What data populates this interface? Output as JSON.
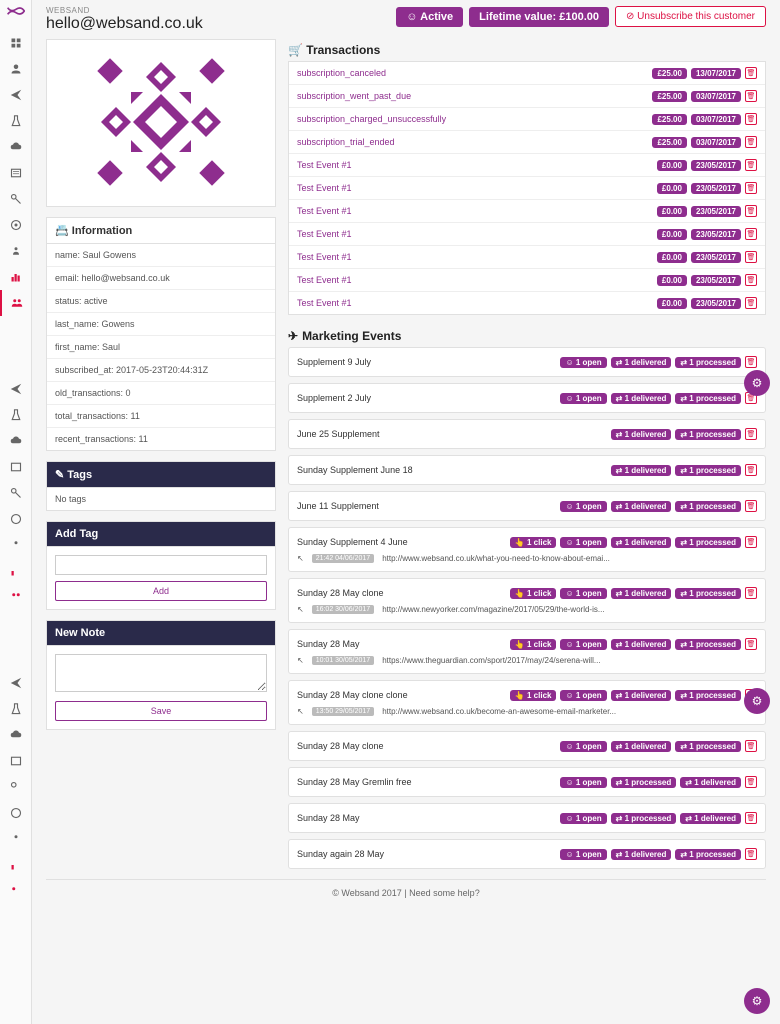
{
  "brand": "WEBSAND",
  "email": "hello@websand.co.uk",
  "status_badge": "☺ Active",
  "ltv_badge": "Lifetime value: £100.00",
  "unsub_btn": "⊘ Unsubscribe this customer",
  "info": {
    "header": "Information",
    "rows": [
      "name: Saul Gowens",
      "email: hello@websand.co.uk",
      "status: active",
      "last_name: Gowens",
      "first_name: Saul",
      "subscribed_at: 2017-05-23T20:44:31Z",
      "old_transactions: 0",
      "total_transactions: 11",
      "recent_transactions: 11"
    ]
  },
  "tags": {
    "header": "✎ Tags",
    "body": "No tags"
  },
  "addtag": {
    "header": "Add Tag",
    "btn": "Add"
  },
  "newnote": {
    "header": "New Note",
    "btn": "Save"
  },
  "tx": {
    "header": "🛒 Transactions",
    "rows": [
      {
        "name": "subscription_canceled",
        "amount": "£25.00",
        "date": "13/07/2017"
      },
      {
        "name": "subscription_went_past_due",
        "amount": "£25.00",
        "date": "03/07/2017"
      },
      {
        "name": "subscription_charged_unsuccessfully",
        "amount": "£25.00",
        "date": "03/07/2017"
      },
      {
        "name": "subscription_trial_ended",
        "amount": "£25.00",
        "date": "03/07/2017"
      },
      {
        "name": "Test Event #1",
        "amount": "£0.00",
        "date": "23/05/2017"
      },
      {
        "name": "Test Event #1",
        "amount": "£0.00",
        "date": "23/05/2017"
      },
      {
        "name": "Test Event #1",
        "amount": "£0.00",
        "date": "23/05/2017"
      },
      {
        "name": "Test Event #1",
        "amount": "£0.00",
        "date": "23/05/2017"
      },
      {
        "name": "Test Event #1",
        "amount": "£0.00",
        "date": "23/05/2017"
      },
      {
        "name": "Test Event #1",
        "amount": "£0.00",
        "date": "23/05/2017"
      },
      {
        "name": "Test Event #1",
        "amount": "£0.00",
        "date": "23/05/2017"
      }
    ]
  },
  "mkt": {
    "header": "Marketing Events",
    "events": [
      {
        "title": "Supplement 9 July",
        "badges": [
          "☺ 1 open",
          "⇄ 1 delivered",
          "⇄ 1 processed"
        ]
      },
      {
        "title": "Supplement 2 July",
        "badges": [
          "☺ 1 open",
          "⇄ 1 delivered",
          "⇄ 1 processed"
        ]
      },
      {
        "title": "June 25 Supplement",
        "badges": [
          "⇄ 1 delivered",
          "⇄ 1 processed"
        ]
      },
      {
        "title": "Sunday Supplement June 18",
        "badges": [
          "⇄ 1 delivered",
          "⇄ 1 processed"
        ]
      },
      {
        "title": "June 11 Supplement",
        "badges": [
          "☺ 1 open",
          "⇄ 1 delivered",
          "⇄ 1 processed"
        ]
      },
      {
        "title": "Sunday Supplement 4 June",
        "badges": [
          "👆 1 click",
          "☺ 1 open",
          "⇄ 1 delivered",
          "⇄ 1 processed"
        ],
        "ts": "21:42 04/06/2017",
        "link": "http://www.websand.co.uk/what-you-need-to-know-about-emai..."
      },
      {
        "title": "Sunday 28 May clone",
        "badges": [
          "👆 1 click",
          "☺ 1 open",
          "⇄ 1 delivered",
          "⇄ 1 processed"
        ],
        "ts": "16:02 30/06/2017",
        "link": "http://www.newyorker.com/magazine/2017/05/29/the-world-is..."
      },
      {
        "title": "Sunday 28 May",
        "badges": [
          "👆 1 click",
          "☺ 1 open",
          "⇄ 1 delivered",
          "⇄ 1 processed"
        ],
        "ts": "10:01 30/05/2017",
        "link": "https://www.theguardian.com/sport/2017/may/24/serena-will..."
      },
      {
        "title": "Sunday 28 May clone clone",
        "badges": [
          "👆 1 click",
          "☺ 1 open",
          "⇄ 1 delivered",
          "⇄ 1 processed"
        ],
        "ts": "13:50 29/05/2017",
        "link": "http://www.websand.co.uk/become-an-awesome-email-marketer..."
      },
      {
        "title": "Sunday 28 May clone",
        "badges": [
          "☺ 1 open",
          "⇄ 1 delivered",
          "⇄ 1 processed"
        ]
      },
      {
        "title": "Sunday 28 May Gremlin free",
        "badges": [
          "☺ 1 open",
          "⇄ 1 processed",
          "⇄ 1 delivered"
        ]
      },
      {
        "title": "Sunday 28 May",
        "badges": [
          "☺ 1 open",
          "⇄ 1 processed",
          "⇄ 1 delivered"
        ]
      },
      {
        "title": "Sunday again 28 May",
        "badges": [
          "☺ 1 open",
          "⇄ 1 delivered",
          "⇄ 1 processed"
        ]
      }
    ]
  },
  "footer": "© Websand 2017 | Need some help?"
}
